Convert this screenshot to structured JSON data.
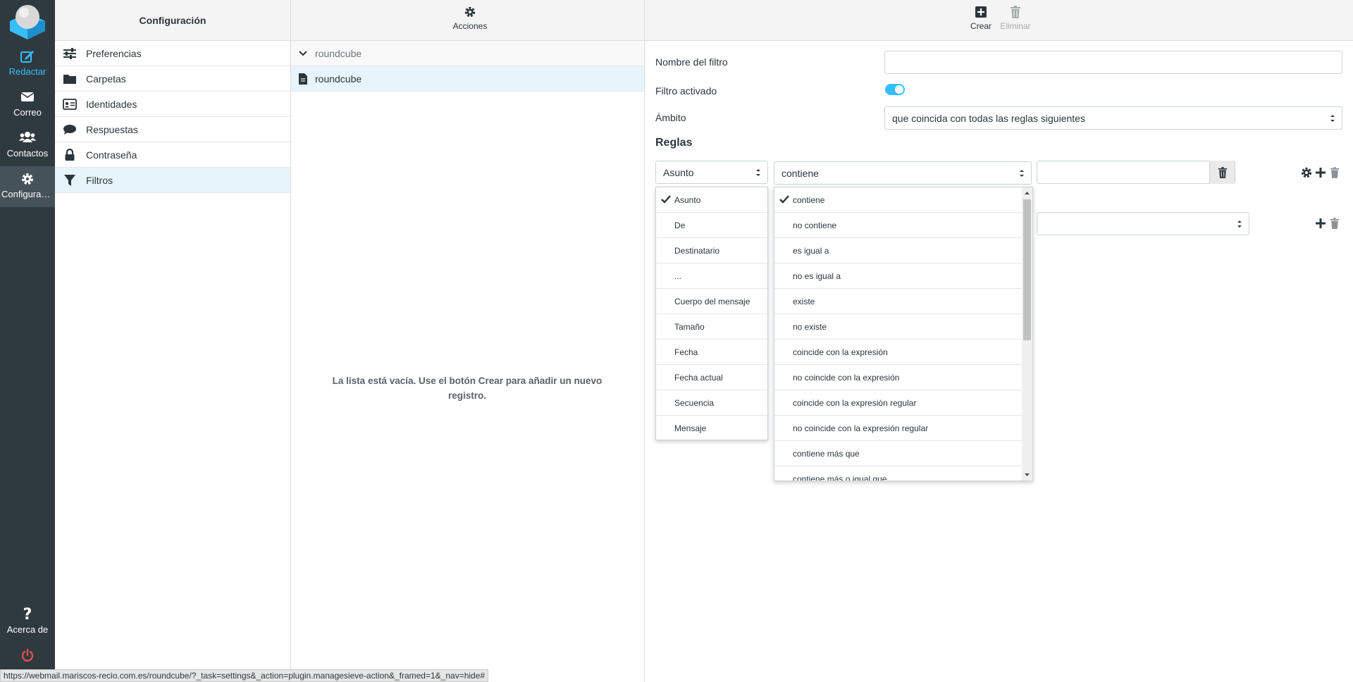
{
  "colors": {
    "accent": "#37beff",
    "nav_bg": "#2f3a3f",
    "logout": "#e44d4d"
  },
  "nav": {
    "compose": {
      "label": "Redactar",
      "icon": "edit-icon"
    },
    "mail": {
      "label": "Correo",
      "icon": "envelope-icon"
    },
    "contacts": {
      "label": "Contactos",
      "icon": "users-icon"
    },
    "settings": {
      "label": "Configuraci...",
      "icon": "gear-icon"
    },
    "about": {
      "label": "Acerca de",
      "icon": "question-icon"
    },
    "logout": {
      "icon": "power-icon"
    }
  },
  "settings_panel": {
    "title": "Configuración",
    "items": [
      {
        "label": "Preferencias",
        "icon": "sliders-icon"
      },
      {
        "label": "Carpetas",
        "icon": "folder-icon"
      },
      {
        "label": "Identidades",
        "icon": "id-card-icon"
      },
      {
        "label": "Respuestas",
        "icon": "comment-icon"
      },
      {
        "label": "Contraseña",
        "icon": "lock-icon"
      },
      {
        "label": "Filtros",
        "icon": "filter-icon"
      }
    ]
  },
  "filters_panel": {
    "actions_label": "Acciones",
    "group": "roundcube",
    "set": "roundcube",
    "empty_message": "La lista está vacía. Use el botón Crear para añadir un nuevo registro."
  },
  "toolbar": {
    "create_label": "Crear",
    "delete_label": "Eliminar"
  },
  "form": {
    "name_label": "Nombre del filtro",
    "name_value": "",
    "enabled_label": "Filtro activado",
    "enabled": true,
    "scope_label": "Ámbito",
    "scope_value": "que coincida con todas las reglas siguientes",
    "rules_title": "Reglas",
    "rule": {
      "header": "Asunto",
      "operator": "contiene",
      "value": ""
    }
  },
  "header_dropdown": {
    "options": [
      "Asunto",
      "De",
      "Destinatario",
      "...",
      "Cuerpo del mensaje",
      "Tamaño",
      "Fecha",
      "Fecha actual",
      "Secuencia",
      "Mensaje"
    ],
    "selected": "Asunto"
  },
  "operator_dropdown": {
    "options": [
      "contiene",
      "no contiene",
      "es igual a",
      "no es igual a",
      "existe",
      "no existe",
      "coincide con la expresión",
      "no coincide con la expresión",
      "coincide con la expresión regular",
      "no coincide con la expresión regular",
      "contiene más que",
      "contiene más o igual que"
    ],
    "selected": "contiene"
  },
  "status_url": "https://webmail.mariscos-recio.com.es/roundcube/?_task=settings&_action=plugin.managesieve-action&_framed=1&_nav=hide#"
}
